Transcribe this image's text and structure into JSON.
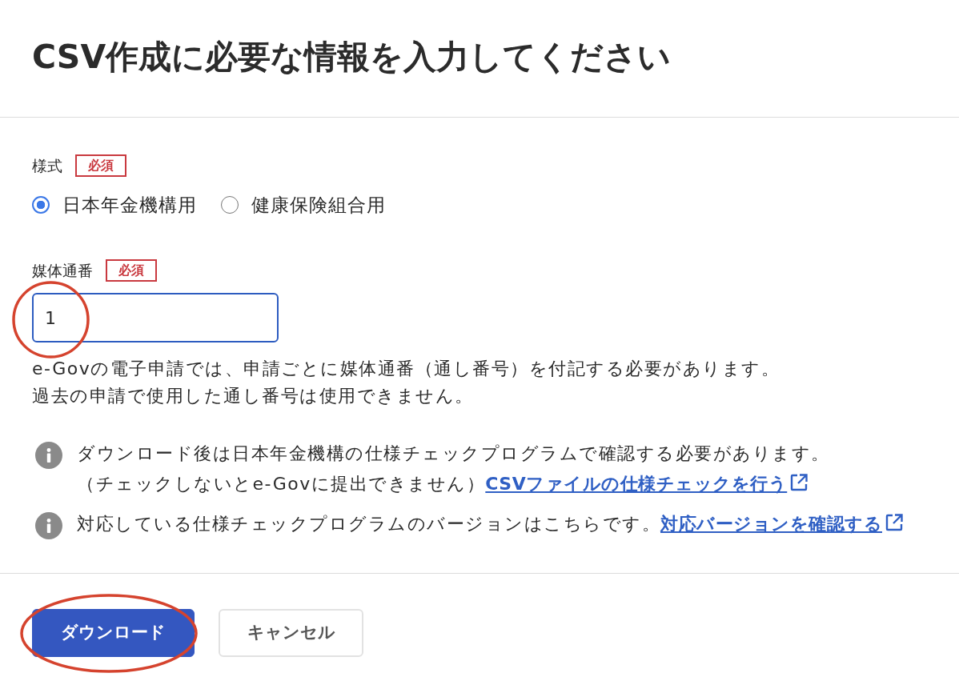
{
  "header": {
    "title": "CSV作成に必要な情報を入力してください"
  },
  "fields": [
    {
      "kind": "radio",
      "label": "様式",
      "badge": "必須",
      "options": [
        {
          "label": "日本年金機構用",
          "selected": true
        },
        {
          "label": "健康保険組合用",
          "selected": false
        }
      ]
    },
    {
      "kind": "text",
      "label": "媒体通番",
      "badge": "必須",
      "value": "1",
      "highlighted": true,
      "help": [
        "e-Govの電子申請では、申請ごとに媒体通番（通し番号）を付記する必要があります。",
        "過去の申請で使用した通し番号は使用できません。"
      ]
    }
  ],
  "notes": [
    {
      "lines": [
        "ダウンロード後は日本年金機構の仕様チェックプログラムで確認する必要があります。",
        "（チェックしないとe-Govに提出できません）"
      ],
      "link": "CSVファイルの仕様チェックを行う"
    },
    {
      "lines": [
        "対応している仕様チェックプログラムのバージョンはこちらです。"
      ],
      "link": "対応バージョンを確認する"
    }
  ],
  "actions": [
    {
      "kind": "primary",
      "label": "ダウンロード",
      "highlighted": true
    },
    {
      "kind": "secondary",
      "label": "キャンセル",
      "highlighted": false
    }
  ]
}
